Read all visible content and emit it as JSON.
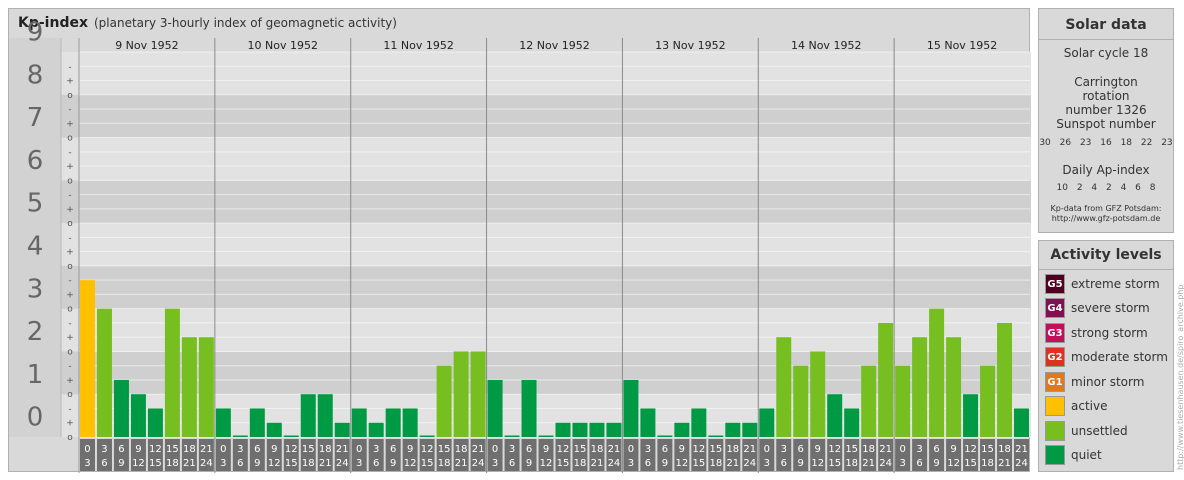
{
  "header": {
    "title": "Kp-index",
    "subtitle": "(planetary 3-hourly index of geomagnetic activity)"
  },
  "chart_data": {
    "type": "bar",
    "y_labels": [
      "0",
      "1",
      "2",
      "3",
      "4",
      "5",
      "6",
      "7",
      "8",
      "9"
    ],
    "third_marks": [
      "o",
      "+",
      "-"
    ],
    "ylim": [
      0,
      9
    ],
    "days": [
      "9 Nov 1952",
      "10 Nov 1952",
      "11 Nov 1952",
      "12 Nov 1952",
      "13 Nov 1952",
      "14 Nov 1952",
      "15 Nov 1952"
    ],
    "x_top": [
      "0",
      "3",
      "6",
      "9",
      "12",
      "15",
      "18",
      "21"
    ],
    "x_bottom": [
      "3",
      "6",
      "9",
      "12",
      "15",
      "18",
      "21",
      "24"
    ],
    "kp_values": [
      [
        3.667,
        3.0,
        1.333,
        1.0,
        0.667,
        3.0,
        2.333,
        2.333
      ],
      [
        0.667,
        0.0,
        0.667,
        0.333,
        0.0,
        1.0,
        1.0,
        0.333
      ],
      [
        0.667,
        0.333,
        0.667,
        0.667,
        0.0,
        1.667,
        2.0,
        2.0
      ],
      [
        1.333,
        0.0,
        1.333,
        0.0,
        0.333,
        0.333,
        0.333,
        0.333
      ],
      [
        1.333,
        0.667,
        0.0,
        0.333,
        0.667,
        0.0,
        0.333,
        0.333
      ],
      [
        0.667,
        2.333,
        1.667,
        2.0,
        1.0,
        0.667,
        1.667,
        2.667
      ],
      [
        1.667,
        2.333,
        3.0,
        2.333,
        1.0,
        1.667,
        2.667,
        0.667
      ]
    ],
    "colors": {
      "quiet": "#009944",
      "unsettled": "#77bf21",
      "active": "#ffc000",
      "g1": "#e07820",
      "g2": "#e03020",
      "g3": "#c0105a",
      "g4": "#801050",
      "g5": "#500020"
    }
  },
  "solar": {
    "title": "Solar data",
    "cycle": "Solar cycle 18",
    "carrington": "Carrington rotation number 1326",
    "sunspot_label": "Sunspot number",
    "sunspot_values": "30 26 23 16 18 22 23",
    "ap_label": "Daily Ap-index",
    "ap_values": "10 2 4 2 4 6 8",
    "source_line1": "Kp-data from GFZ Potsdam:",
    "source_line2": "http://www.gfz-potsdam.de"
  },
  "activity": {
    "title": "Activity levels",
    "items": [
      {
        "badge": "G5",
        "label": "extreme storm",
        "color": "#500020"
      },
      {
        "badge": "G4",
        "label": "severe storm",
        "color": "#801050"
      },
      {
        "badge": "G3",
        "label": "strong storm",
        "color": "#c0105a"
      },
      {
        "badge": "G2",
        "label": "moderate storm",
        "color": "#e03020"
      },
      {
        "badge": "G1",
        "label": "minor storm",
        "color": "#e07820"
      },
      {
        "badge": "",
        "label": "active",
        "color": "#ffc000"
      },
      {
        "badge": "",
        "label": "unsettled",
        "color": "#77bf21"
      },
      {
        "badge": "",
        "label": "quiet",
        "color": "#009944"
      }
    ]
  },
  "credit": "http://www.tiesenhausen.de/spiro_archive.php"
}
